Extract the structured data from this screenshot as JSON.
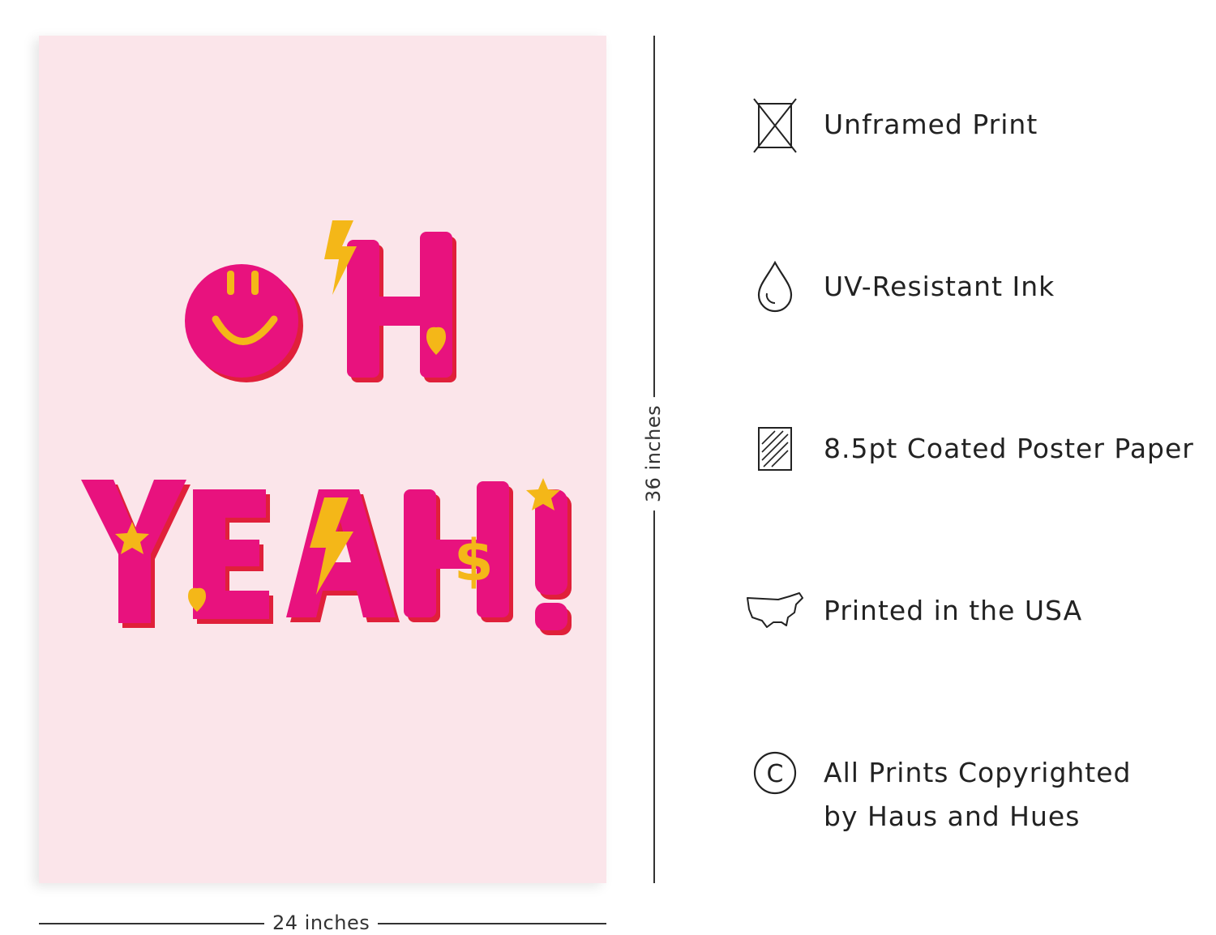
{
  "poster": {
    "line1": "OH",
    "line2": "YEAH!",
    "background_color": "#fbe5ea",
    "letter_color": "#e8127e",
    "accent_color": "#f4b718"
  },
  "dimensions": {
    "width_label": "24 inches",
    "height_label": "36 inches"
  },
  "features": [
    {
      "icon": "unframed-box-icon",
      "label": "Unframed Print"
    },
    {
      "icon": "ink-drop-icon",
      "label": "UV-Resistant Ink"
    },
    {
      "icon": "paper-icon",
      "label": "8.5pt Coated Poster Paper"
    },
    {
      "icon": "usa-map-icon",
      "label": "Printed in the USA"
    },
    {
      "icon": "copyright-icon",
      "label": "All Prints Copyrighted",
      "label_line2": "by Haus and Hues"
    }
  ]
}
